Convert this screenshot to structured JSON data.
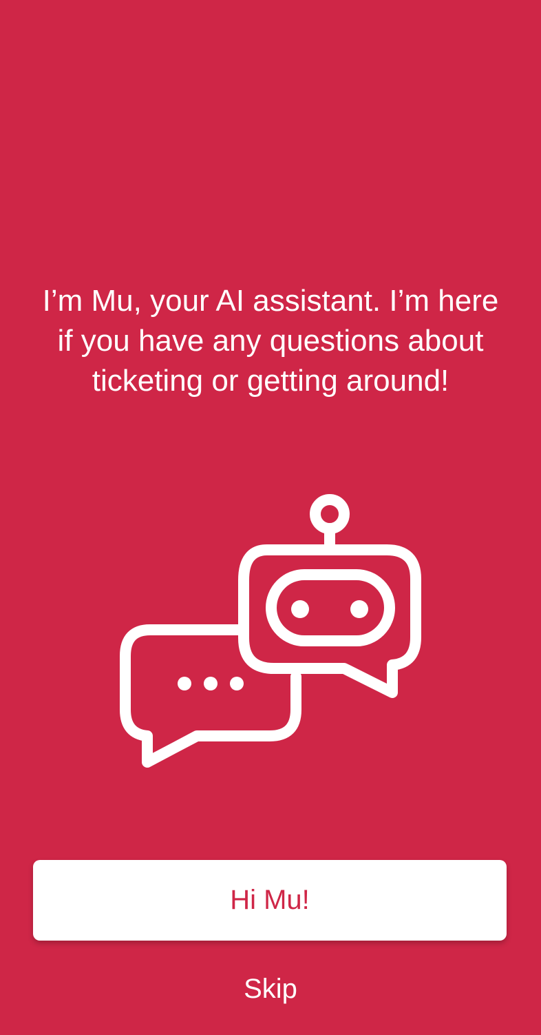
{
  "intro": {
    "message": "I’m Mu, your AI assistant. I’m here if you have any questions about ticketing or getting around!"
  },
  "illustration": {
    "icon": "robot-chat-icon"
  },
  "actions": {
    "primary_label": "Hi Mu!",
    "skip_label": "Skip"
  },
  "colors": {
    "background": "#CF2647",
    "button_background": "#FFFFFF",
    "button_text": "#CF2647",
    "text": "#FFFFFF"
  }
}
